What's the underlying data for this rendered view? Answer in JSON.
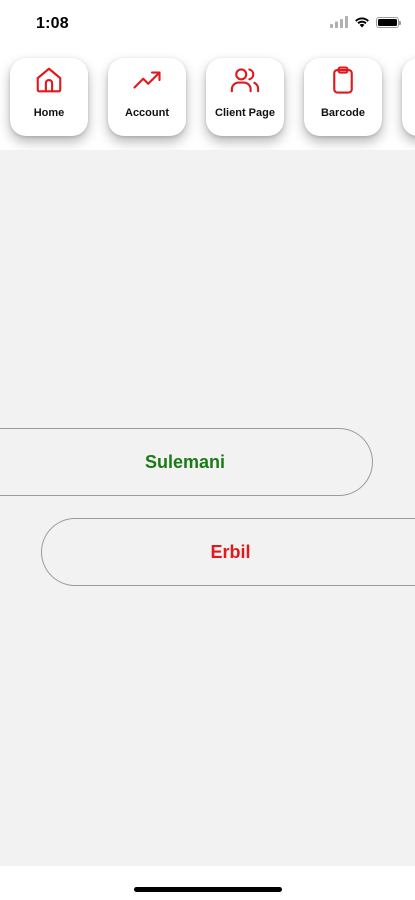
{
  "status_bar": {
    "time": "1:08",
    "icons": [
      "signal-icon",
      "wifi-icon",
      "battery-icon"
    ]
  },
  "nav": {
    "items": [
      {
        "label": "Home",
        "icon": "home-icon"
      },
      {
        "label": "Account",
        "icon": "trending-up-icon"
      },
      {
        "label": "Client Page",
        "icon": "users-icon"
      },
      {
        "label": "Barcode",
        "icon": "clipboard-icon"
      },
      {
        "label": "",
        "icon": "partial-tile"
      }
    ]
  },
  "locations": {
    "sulemani": "Sulemani",
    "erbil": "Erbil"
  },
  "colors": {
    "accent": "#e0191e",
    "sulemani_text": "#1a7a14",
    "erbil_text": "#e0191e",
    "background": "#f2f2f2"
  }
}
